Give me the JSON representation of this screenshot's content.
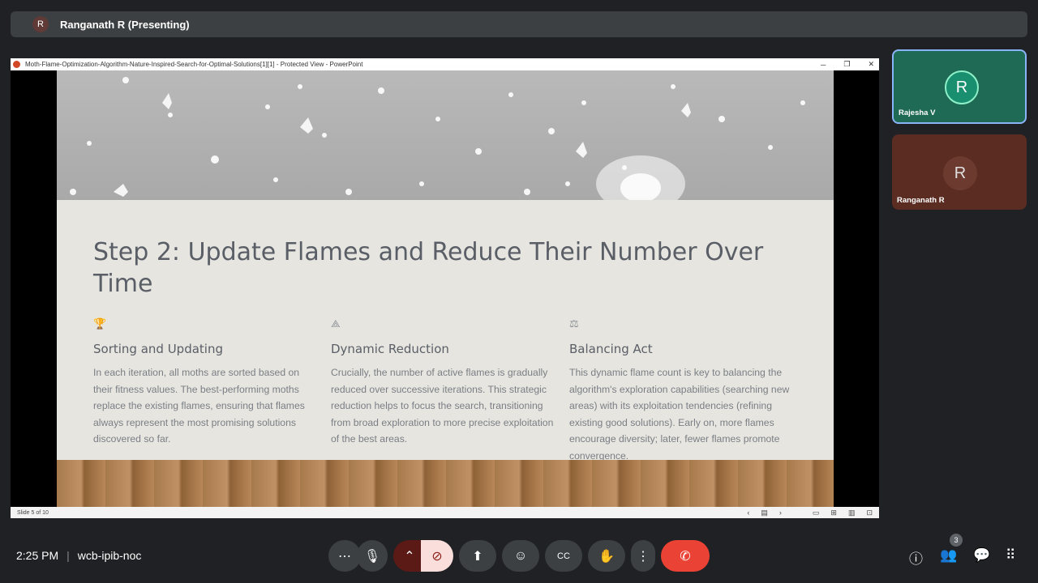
{
  "top_bar": {
    "avatar_letter": "R",
    "presenter": "Ranganath R (Presenting)"
  },
  "window": {
    "title": "Moth-Flame-Optimization-Algorithm-Nature-Inspired-Search-for-Optimal-Solutions[1][1]  -  Protected View - PowerPoint",
    "minimize": "─",
    "restore": "❐",
    "close": "✕"
  },
  "slide": {
    "title": "Step 2: Update Flames and Reduce Their Number Over Time",
    "columns": [
      {
        "icon": "trophy-icon",
        "glyph": "🏆",
        "heading": "Sorting and Updating",
        "body": "In each iteration, all moths are sorted based on their fitness values. The best-performing moths replace the existing flames, ensuring that flames always represent the most promising solutions discovered so far."
      },
      {
        "icon": "pyramid-icon",
        "glyph": "⟁",
        "heading": "Dynamic Reduction",
        "body": "Crucially, the number of active flames is gradually reduced over successive iterations. This strategic reduction helps to focus the search, transitioning from broad exploration to more precise exploitation of the best areas."
      },
      {
        "icon": "scales-icon",
        "glyph": "⚖",
        "heading": "Balancing Act",
        "body": "This dynamic flame count is key to balancing the algorithm's exploration capabilities (searching new areas) with its exploitation tendencies (refining existing good solutions). Early on, more flames encourage diversity; later, fewer flames promote convergence."
      }
    ]
  },
  "status_bar": {
    "slide_count": "Slide 5 of 10",
    "prev": "‹",
    "notes": "▤",
    "next": "›",
    "normal": "▭",
    "sorter": "⊞",
    "reading": "▥",
    "slideshow": "⊡"
  },
  "participants": [
    {
      "initial": "R",
      "name": "Rajesha V"
    },
    {
      "initial": "R",
      "name": "Ranganath R"
    }
  ],
  "meeting": {
    "time": "2:25 PM",
    "separator": "|",
    "code": "wcb-ipib-noc",
    "people_count": "3"
  },
  "controls": {
    "more": "⋯",
    "mic": "🎙",
    "arrow": "⌃",
    "camera": "⊘",
    "present": "⬆",
    "emoji": "☺",
    "captions": "CC",
    "hand": "✋",
    "options": "⋮",
    "end": "✆"
  },
  "side_icons": {
    "info": "ⓘ",
    "people": "👥",
    "chat": "💬",
    "apps": "⠿"
  }
}
